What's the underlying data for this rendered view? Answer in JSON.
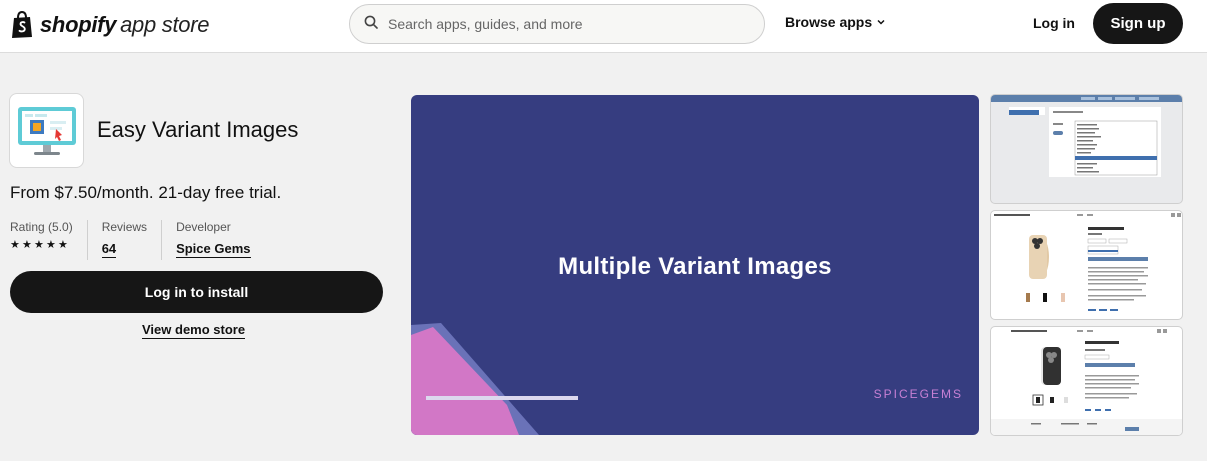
{
  "header": {
    "logo_bold": "shopify",
    "logo_light": "app store",
    "search_placeholder": "Search apps, guides, and more",
    "browse_label": "Browse apps",
    "login_label": "Log in",
    "signup_label": "Sign up"
  },
  "app": {
    "title": "Easy Variant Images",
    "pricing": "From $7.50/month. 21-day free trial.",
    "rating_label": "Rating (5.0)",
    "rating_stars": 5,
    "reviews_label": "Reviews",
    "reviews_count": "64",
    "developer_label": "Developer",
    "developer_name": "Spice Gems",
    "install_label": "Log in to install",
    "demo_label": "View demo store"
  },
  "media": {
    "hero_title": "Multiple Variant Images",
    "hero_brand": "SPICEGEMS"
  },
  "colors": {
    "hero_bg": "#363d80",
    "hero_pink": "#d277c6",
    "hero_stripe": "#6a72b8",
    "button_dark": "#161616",
    "brand_green": "#95bf47"
  }
}
